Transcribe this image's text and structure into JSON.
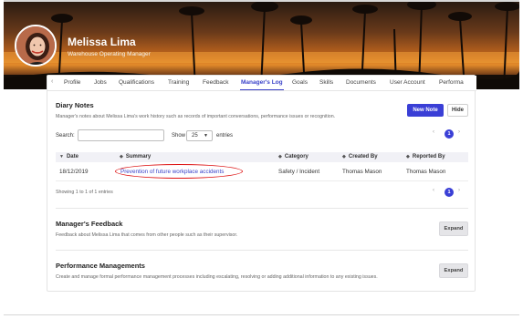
{
  "profile": {
    "name": "Melissa Lima",
    "role": "Warehouse Operating Manager"
  },
  "tabs": {
    "prev_icon": "chevron-left",
    "items": [
      "Profile",
      "Jobs",
      "Qualifications",
      "Training",
      "Feedback",
      "Manager's Log",
      "Goals",
      "Skills",
      "Documents",
      "User Account",
      "Performa"
    ],
    "active": "Manager's Log"
  },
  "diary": {
    "title": "Diary Notes",
    "description": "Manager's notes about Melissa Lima's work history such as records of important conversations, performance issues or recognition.",
    "new_note_label": "New Note",
    "hide_label": "Hide",
    "search_label": "Search:",
    "search_value": "",
    "show_label": "Show",
    "entries_value": "25",
    "entries_label": "entries",
    "page_current": "1",
    "columns": [
      "Date",
      "Summary",
      "Category",
      "Created By",
      "Reported By"
    ],
    "rows": [
      {
        "date": "18/12/2019",
        "summary": "Prevention of future workplace accidents",
        "category": "Safety / Incident",
        "created_by": "Thomas Mason",
        "reported_by": "Thomas Mason"
      }
    ],
    "showing_text": "Showing 1 to 1 of 1 entries"
  },
  "feedback": {
    "title": "Manager's Feedback",
    "description": "Feedback about Melissa Lima that comes from other people such as their supervisor.",
    "expand_label": "Expand"
  },
  "performance": {
    "title": "Performance Managements",
    "description": "Create and manage formal performance management processes including escalating, resolving or adding additional information to any existing issues.",
    "expand_label": "Expand"
  },
  "colors": {
    "accent": "#3a42c9",
    "annotation": "#d11111"
  }
}
